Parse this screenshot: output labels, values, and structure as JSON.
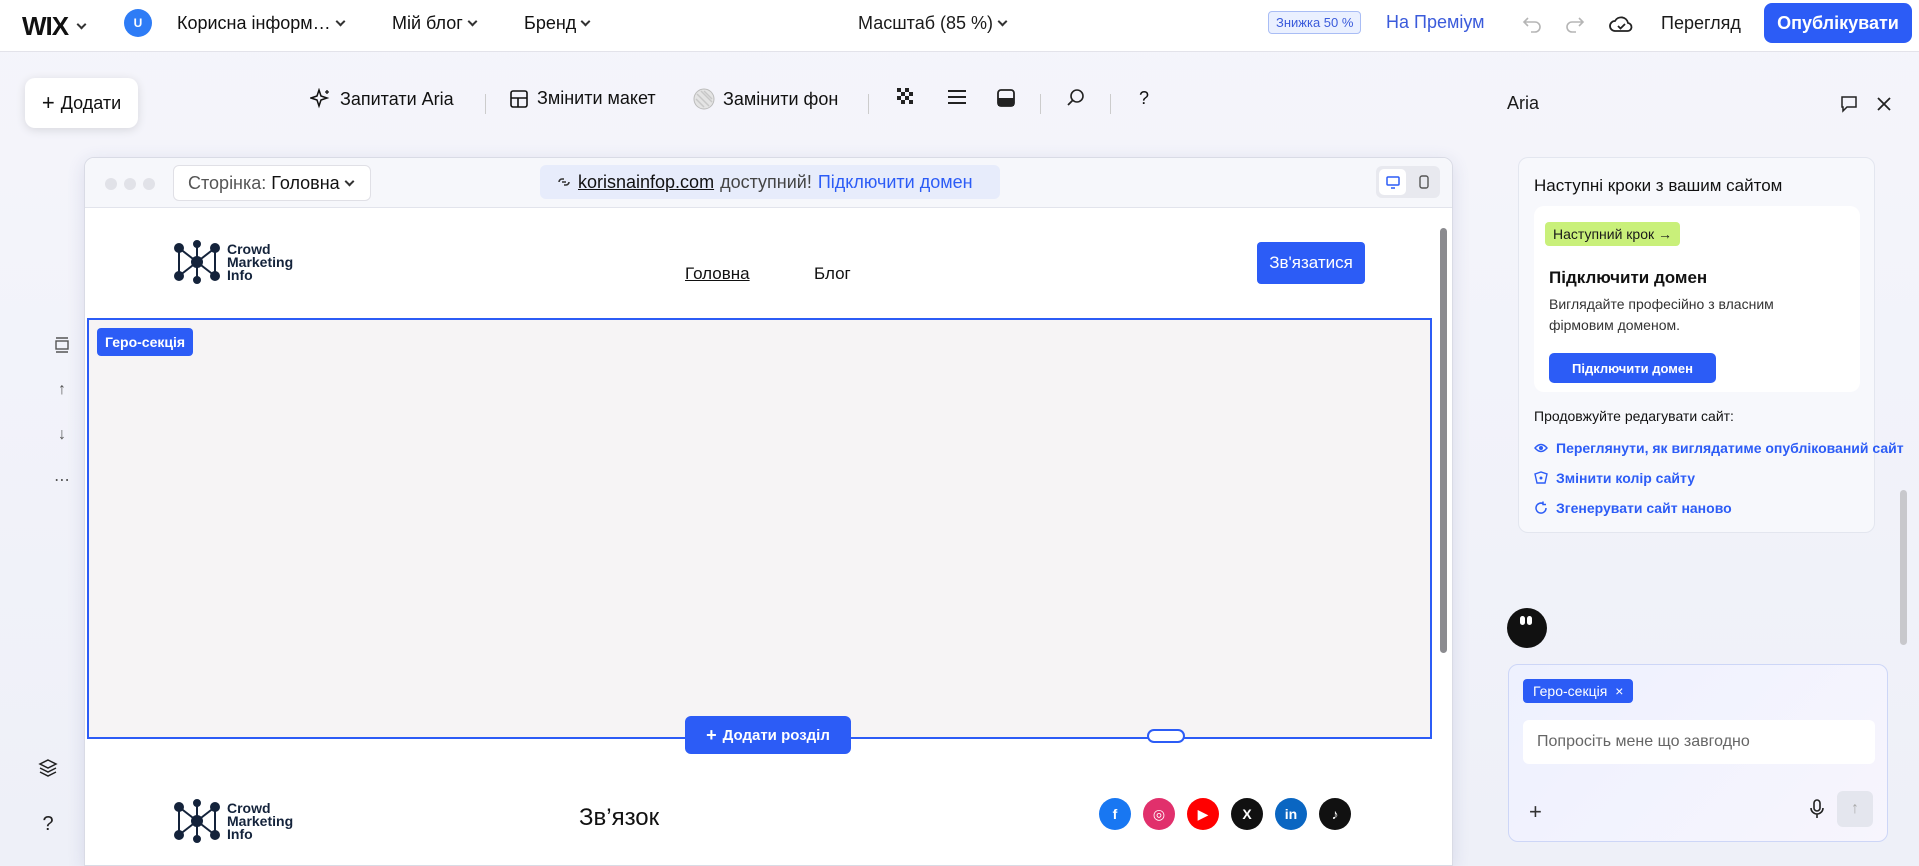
{
  "topbar": {
    "logo": "WIX",
    "avatar_initial": "U",
    "site_menu": "Корисна інформ…",
    "blog_menu": "Мій блог",
    "brand_menu": "Бренд",
    "zoom": "Масштаб (85 %)",
    "discount": "Знижка 50 %",
    "premium": "На Преміум",
    "preview": "Перегляд",
    "publish": "Опублікувати"
  },
  "toolbar": {
    "add": "Додати",
    "ask_aria": "Запитати Aria",
    "change_layout": "Змінити макет",
    "change_bg": "Замінити фон",
    "help": "?"
  },
  "canvas": {
    "page_label": "Сторінка:",
    "page_value": "Головна",
    "domain": "korisnainfop.com",
    "available": "доступний!",
    "connect_domain": "Підключити домен"
  },
  "site": {
    "logo_line1": "Crowd",
    "logo_line2": "Marketing",
    "logo_line3": "Info",
    "nav": [
      "Головна",
      "Блог"
    ],
    "contact_button": "Зв'язатися",
    "hero_tag": "Геро-секція",
    "add_section": "Додати розділ",
    "footer_title": "Зв’язок"
  },
  "aria": {
    "title": "Aria",
    "panel_title": "Наступні кроки з вашим сайтом",
    "next_step_badge": "Наступний крок",
    "card_title": "Підключити домен",
    "card_desc": "Виглядайте професійно з власним фірмовим доменом.",
    "card_button": "Підключити домен",
    "continue_label": "Продовжуйте редагувати сайт:",
    "links": [
      "Переглянути, як виглядатиме опублікований сайт",
      "Змінити колір сайту",
      "Згенерувати сайт наново"
    ],
    "chip": "Геро-секція",
    "input_placeholder": "Попросіть мене що завгодно"
  },
  "colors": {
    "accent": "#2c5cf6",
    "badge_green": "#c9f07a",
    "hero_bg": "#f6f4f5"
  }
}
